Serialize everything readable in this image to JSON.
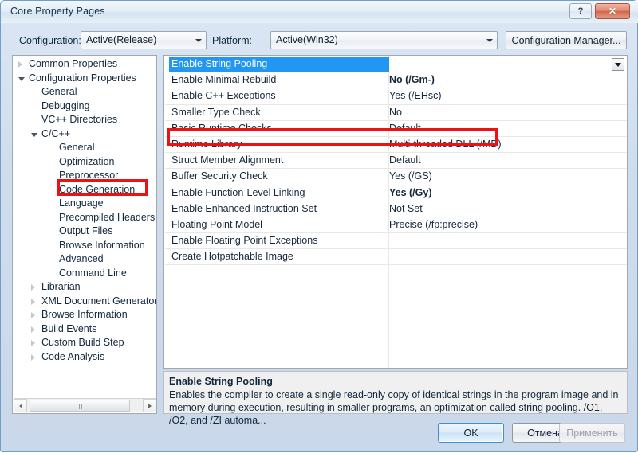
{
  "window": {
    "title": "Core Property Pages",
    "help_button": "?",
    "close_button": "✕"
  },
  "config_bar": {
    "configuration_label": "Configuration:",
    "configuration_value": "Active(Release)",
    "platform_label": "Platform:",
    "platform_value": "Active(Win32)",
    "configuration_manager_button": "Configuration Manager..."
  },
  "tree": {
    "nodes": [
      {
        "label": "Common Properties",
        "indent": 0,
        "expander": "closed",
        "selected": false
      },
      {
        "label": "Configuration Properties",
        "indent": 0,
        "expander": "open",
        "selected": false
      },
      {
        "label": "General",
        "indent": 1,
        "expander": "none",
        "selected": false
      },
      {
        "label": "Debugging",
        "indent": 1,
        "expander": "none",
        "selected": false
      },
      {
        "label": "VC++ Directories",
        "indent": 1,
        "expander": "none",
        "selected": false
      },
      {
        "label": "C/C++",
        "indent": 1,
        "expander": "open",
        "selected": false
      },
      {
        "label": "General",
        "indent": 2,
        "expander": "none",
        "selected": false
      },
      {
        "label": "Optimization",
        "indent": 2,
        "expander": "none",
        "selected": false
      },
      {
        "label": "Preprocessor",
        "indent": 2,
        "expander": "none",
        "selected": false
      },
      {
        "label": "Code Generation",
        "indent": 2,
        "expander": "none",
        "selected": true
      },
      {
        "label": "Language",
        "indent": 2,
        "expander": "none",
        "selected": false
      },
      {
        "label": "Precompiled Headers",
        "indent": 2,
        "expander": "none",
        "selected": false
      },
      {
        "label": "Output Files",
        "indent": 2,
        "expander": "none",
        "selected": false
      },
      {
        "label": "Browse Information",
        "indent": 2,
        "expander": "none",
        "selected": false
      },
      {
        "label": "Advanced",
        "indent": 2,
        "expander": "none",
        "selected": false
      },
      {
        "label": "Command Line",
        "indent": 2,
        "expander": "none",
        "selected": false
      },
      {
        "label": "Librarian",
        "indent": 1,
        "expander": "closed",
        "selected": false
      },
      {
        "label": "XML Document Generator",
        "indent": 1,
        "expander": "closed",
        "selected": false
      },
      {
        "label": "Browse Information",
        "indent": 1,
        "expander": "closed",
        "selected": false
      },
      {
        "label": "Build Events",
        "indent": 1,
        "expander": "closed",
        "selected": false
      },
      {
        "label": "Custom Build Step",
        "indent": 1,
        "expander": "closed",
        "selected": false
      },
      {
        "label": "Code Analysis",
        "indent": 1,
        "expander": "closed",
        "selected": false
      }
    ],
    "hscrollbar": {
      "left_arrow": "◀",
      "right_arrow": "▶"
    }
  },
  "property_grid": {
    "rows": [
      {
        "name": "Enable String Pooling",
        "value": "",
        "bold": false,
        "selected": true
      },
      {
        "name": "Enable Minimal Rebuild",
        "value": "No (/Gm-)",
        "bold": true,
        "selected": false
      },
      {
        "name": "Enable C++ Exceptions",
        "value": "Yes (/EHsc)",
        "bold": false,
        "selected": false
      },
      {
        "name": "Smaller Type Check",
        "value": "No",
        "bold": false,
        "selected": false
      },
      {
        "name": "Basic Runtime Checks",
        "value": "Default",
        "bold": false,
        "selected": false
      },
      {
        "name": "Runtime Library",
        "value": "Multi-threaded DLL (/MD)",
        "bold": false,
        "selected": false
      },
      {
        "name": "Struct Member Alignment",
        "value": "Default",
        "bold": false,
        "selected": false
      },
      {
        "name": "Buffer Security Check",
        "value": "Yes (/GS)",
        "bold": false,
        "selected": false
      },
      {
        "name": "Enable Function-Level Linking",
        "value": "Yes (/Gy)",
        "bold": true,
        "selected": false
      },
      {
        "name": "Enable Enhanced Instruction Set",
        "value": "Not Set",
        "bold": false,
        "selected": false
      },
      {
        "name": "Floating Point Model",
        "value": "Precise (/fp:precise)",
        "bold": false,
        "selected": false
      },
      {
        "name": "Enable Floating Point Exceptions",
        "value": "",
        "bold": false,
        "selected": false
      },
      {
        "name": "Create Hotpatchable Image",
        "value": "",
        "bold": false,
        "selected": false
      }
    ]
  },
  "description": {
    "title": "Enable String Pooling",
    "body": "Enables the compiler to create a single read-only copy of identical strings in the program image and in memory during execution, resulting in smaller programs, an optimization called string pooling. /O1, /O2, and /ZI  automa..."
  },
  "footer": {
    "ok_label": "OK",
    "cancel_label": "Отмена",
    "apply_label": "Применить"
  },
  "annotations": {
    "highlight_color": "#ee1111",
    "boxes": [
      "Code Generation",
      "Runtime Library"
    ]
  }
}
